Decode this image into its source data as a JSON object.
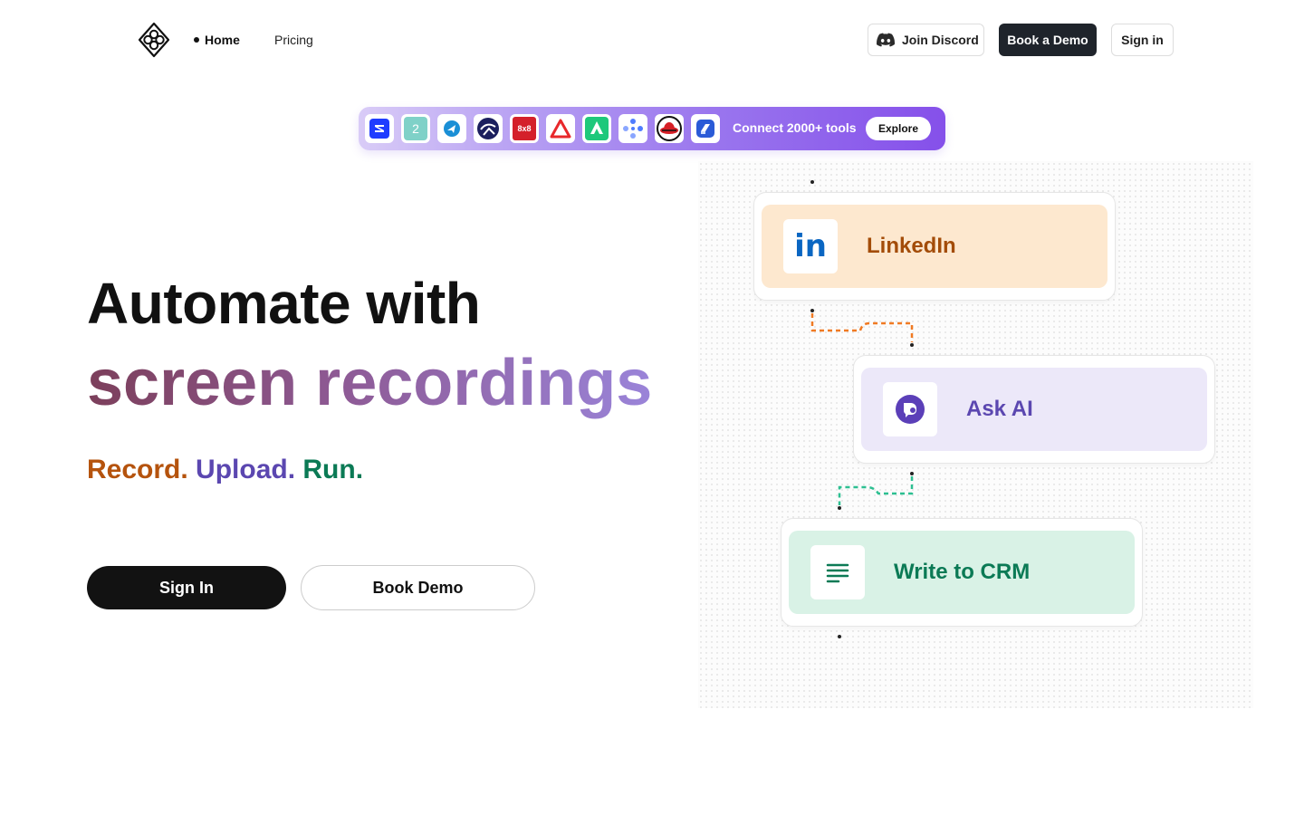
{
  "nav": {
    "home_label": "Home",
    "pricing_label": "Pricing",
    "discord_label": "Join Discord",
    "book_demo_label": "Book a Demo",
    "sign_in_label": "Sign in"
  },
  "integrations": {
    "tools": [
      {
        "name": "blue-square-logo-icon",
        "color": "#1f3cff"
      },
      {
        "name": "number-two-logo-icon",
        "color": "#7fd1c8",
        "text": "2"
      },
      {
        "name": "blue-bird-logo-icon",
        "color": "#1a8fd6"
      },
      {
        "name": "dark-circle-logo-icon",
        "color": "#1b1f5e"
      },
      {
        "name": "8x8-logo-icon",
        "color": "#d4202a",
        "text": "8x8"
      },
      {
        "name": "red-triangle-logo-icon",
        "color": "#e8282b"
      },
      {
        "name": "green-arrow-logo-icon",
        "color": "#1ec87b"
      },
      {
        "name": "dots-network-logo-icon",
        "color": "#4f7cff"
      },
      {
        "name": "red-hat-logo-icon",
        "color": "#d61f26"
      },
      {
        "name": "blue-cube-logo-icon",
        "color": "#2a5bd7"
      }
    ],
    "text": "Connect 2000+ tools",
    "explore_label": "Explore"
  },
  "hero": {
    "line1": "Automate with",
    "line2": "screen recordings",
    "tag_record": "Record.",
    "tag_upload": "Upload.",
    "tag_run": "Run.",
    "sign_in_label": "Sign In",
    "book_demo_label": "Book Demo"
  },
  "flow": {
    "nodes": [
      {
        "label": "LinkedIn",
        "icon": "linkedin-icon",
        "icon_text": "in",
        "bg": "#fde8cf",
        "color": "#a34c08"
      },
      {
        "label": "Ask AI",
        "icon": "ai-chat-icon",
        "bg": "#ece8f9",
        "color": "#5b47b0"
      },
      {
        "label": "Write to CRM",
        "icon": "lines-list-icon",
        "bg": "#d9f2e6",
        "color": "#0b7a55"
      }
    ],
    "connector_colors": [
      "#f07a23",
      "#2dbf91"
    ]
  }
}
